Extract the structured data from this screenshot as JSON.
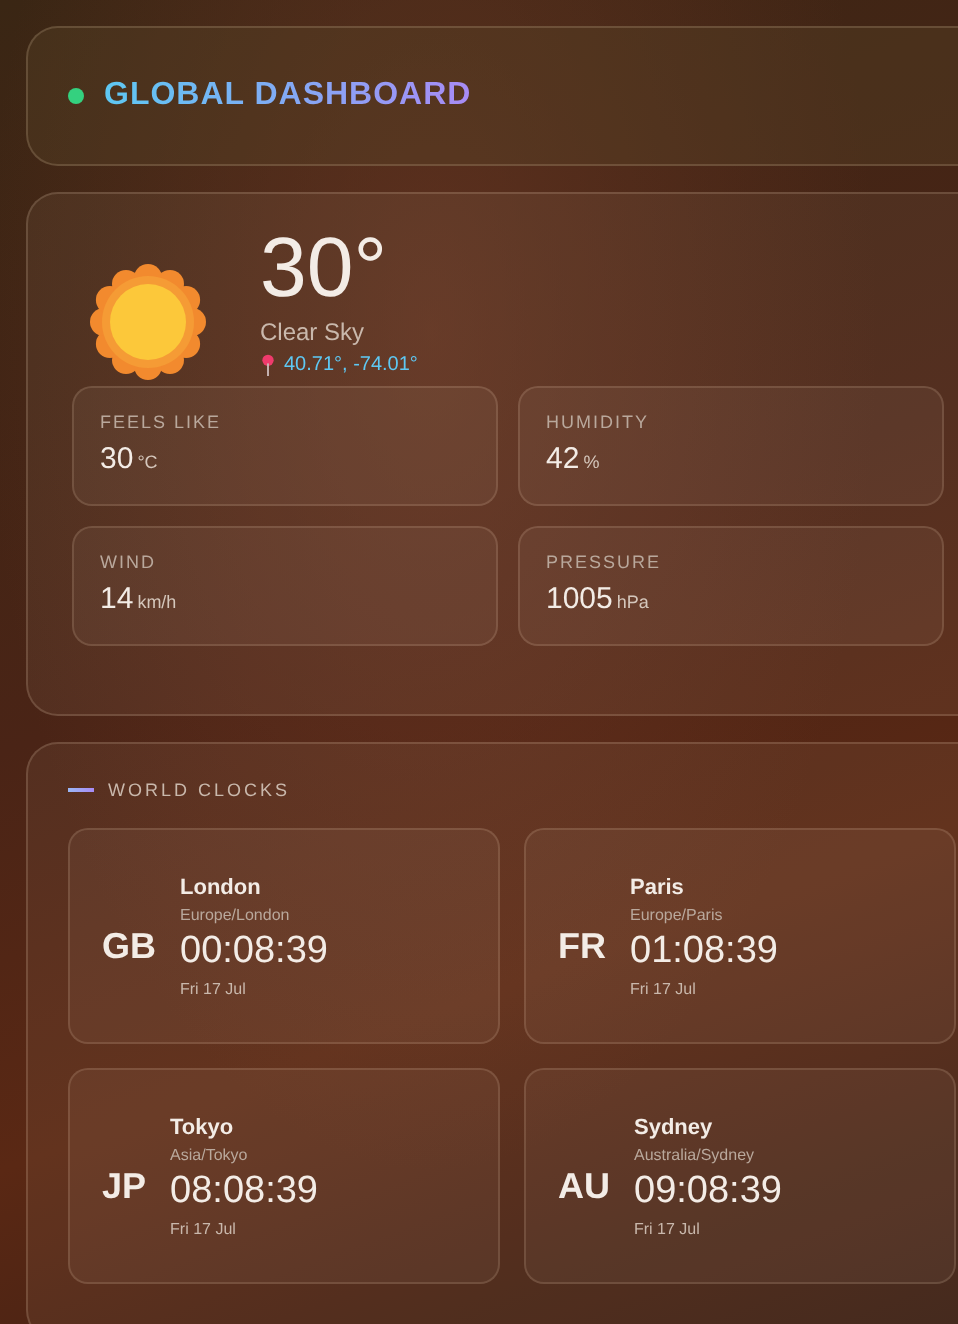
{
  "header": {
    "title": "GLOBAL DASHBOARD"
  },
  "weather": {
    "temperature": "30°",
    "condition": "Clear Sky",
    "coordinates": "40.71°, -74.01°",
    "stats": [
      {
        "label": "FEELS LIKE",
        "value": "30",
        "unit": "°C"
      },
      {
        "label": "HUMIDITY",
        "value": "42",
        "unit": "%"
      },
      {
        "label": "WIND",
        "value": "14",
        "unit": "km/h"
      },
      {
        "label": "PRESSURE",
        "value": "1005",
        "unit": "hPa"
      }
    ]
  },
  "world_clocks": {
    "title": "WORLD CLOCKS",
    "clocks": [
      {
        "code": "GB",
        "city": "London",
        "zone": "Europe/London",
        "time": "00:08:39",
        "date": "Fri 17 Jul"
      },
      {
        "code": "FR",
        "city": "Paris",
        "zone": "Europe/Paris",
        "time": "01:08:39",
        "date": "Fri 17 Jul"
      },
      {
        "code": "JP",
        "city": "Tokyo",
        "zone": "Asia/Tokyo",
        "time": "08:08:39",
        "date": "Fri 17 Jul"
      },
      {
        "code": "AU",
        "city": "Sydney",
        "zone": "Australia/Sydney",
        "time": "09:08:39",
        "date": "Fri 17 Jul"
      }
    ]
  }
}
